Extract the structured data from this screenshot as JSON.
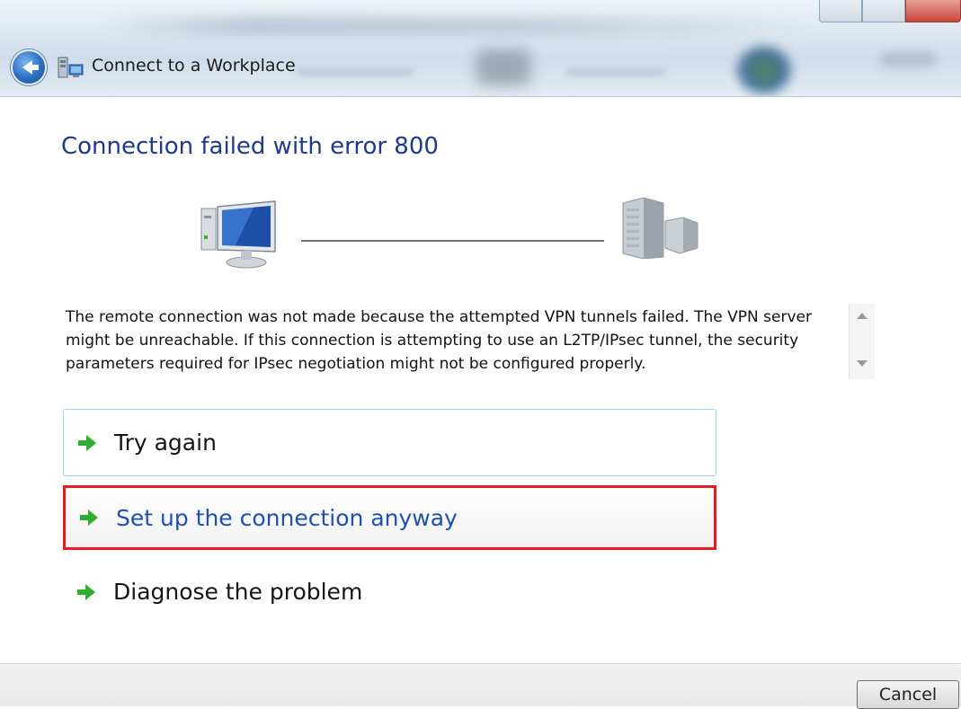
{
  "window": {
    "title": "Connect to a Workplace"
  },
  "main": {
    "heading": "Connection failed with error 800",
    "message": "The remote connection was not made because the attempted VPN tunnels failed. The VPN server might be unreachable. If this connection is attempting to use an L2TP/IPsec tunnel, the security parameters required for IPsec negotiation might not be configured properly."
  },
  "options": [
    {
      "label": "Try again"
    },
    {
      "label": "Set up the connection anyway"
    },
    {
      "label": "Diagnose the problem"
    }
  ],
  "footer": {
    "cancel_label": "Cancel"
  },
  "colors": {
    "heading": "#1e3a8a",
    "link_selected": "#1f4fb0",
    "highlight_border": "#e81c1c",
    "arrow_green": "#2fae2f"
  },
  "icons": {
    "back": "back-arrow-icon",
    "app": "workplace-network-icon",
    "client": "computer-icon",
    "server": "server-icon",
    "option_arrow": "green-arrow-icon"
  }
}
